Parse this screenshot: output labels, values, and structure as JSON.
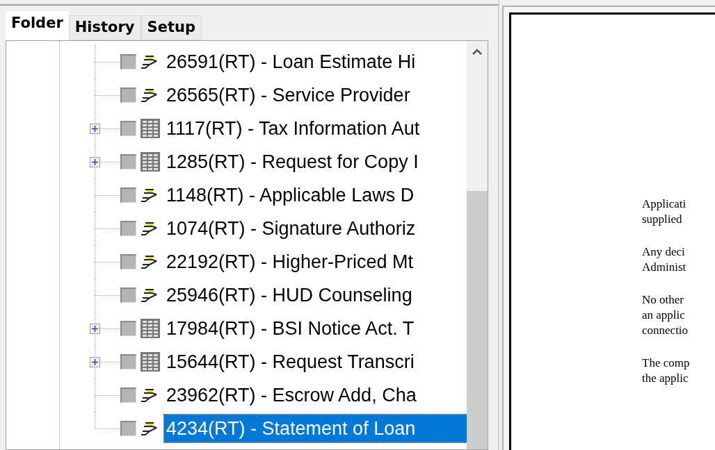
{
  "tabs": [
    {
      "label": "Folder",
      "selected": true
    },
    {
      "label": "History",
      "selected": false
    },
    {
      "label": "Setup",
      "selected": false
    }
  ],
  "tree": {
    "items": [
      {
        "kind": "form",
        "expandable": false,
        "checked": false,
        "selected": false,
        "label": "26591(RT) - Loan Estimate Hi"
      },
      {
        "kind": "form",
        "expandable": false,
        "checked": false,
        "selected": false,
        "label": "26565(RT) - Service Provider"
      },
      {
        "kind": "table",
        "expandable": true,
        "checked": false,
        "selected": false,
        "label": "1117(RT) - Tax Information Aut"
      },
      {
        "kind": "table",
        "expandable": true,
        "checked": false,
        "selected": false,
        "label": "1285(RT) - Request for Copy I"
      },
      {
        "kind": "form",
        "expandable": false,
        "checked": false,
        "selected": false,
        "label": "1148(RT) - Applicable Laws D"
      },
      {
        "kind": "form",
        "expandable": false,
        "checked": false,
        "selected": false,
        "label": "1074(RT) - Signature Authoriz"
      },
      {
        "kind": "form",
        "expandable": false,
        "checked": false,
        "selected": false,
        "label": "22192(RT) - Higher-Priced Mt"
      },
      {
        "kind": "form",
        "expandable": false,
        "checked": false,
        "selected": false,
        "label": "25946(RT) - HUD Counseling"
      },
      {
        "kind": "table",
        "expandable": true,
        "checked": false,
        "selected": false,
        "label": "17984(RT) - BSI Notice Act. T"
      },
      {
        "kind": "table",
        "expandable": true,
        "checked": false,
        "selected": false,
        "label": "15644(RT) - Request Transcri"
      },
      {
        "kind": "form",
        "expandable": false,
        "checked": false,
        "selected": false,
        "label": "23962(RT) - Escrow Add, Cha"
      },
      {
        "kind": "form",
        "expandable": false,
        "checked": false,
        "selected": true,
        "label": "4234(RT) - Statement of Loan"
      }
    ]
  },
  "document": {
    "paragraphs": [
      [
        "Applicati",
        "supplied"
      ],
      [
        "Any deci",
        "Administ"
      ],
      [
        "No other",
        "an applic",
        "connectio"
      ],
      [
        "The comp",
        "the applic"
      ]
    ]
  }
}
